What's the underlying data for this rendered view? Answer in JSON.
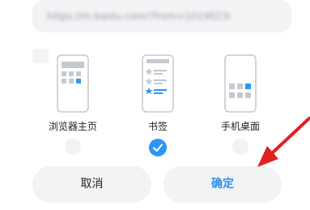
{
  "url_field": {
    "value": "https://m.baidu.com/?from=1019023i"
  },
  "options": [
    {
      "label": "浏览器主页",
      "selected": false
    },
    {
      "label": "书签",
      "selected": true
    },
    {
      "label": "手机桌面",
      "selected": false
    }
  ],
  "buttons": {
    "cancel_label": "取消",
    "confirm_label": "确定"
  },
  "colors": {
    "accent": "#2f95f5",
    "confirm_text": "#2b8fea",
    "preview_gray": "#c4c9d0",
    "annotation_arrow": "#e02020"
  }
}
